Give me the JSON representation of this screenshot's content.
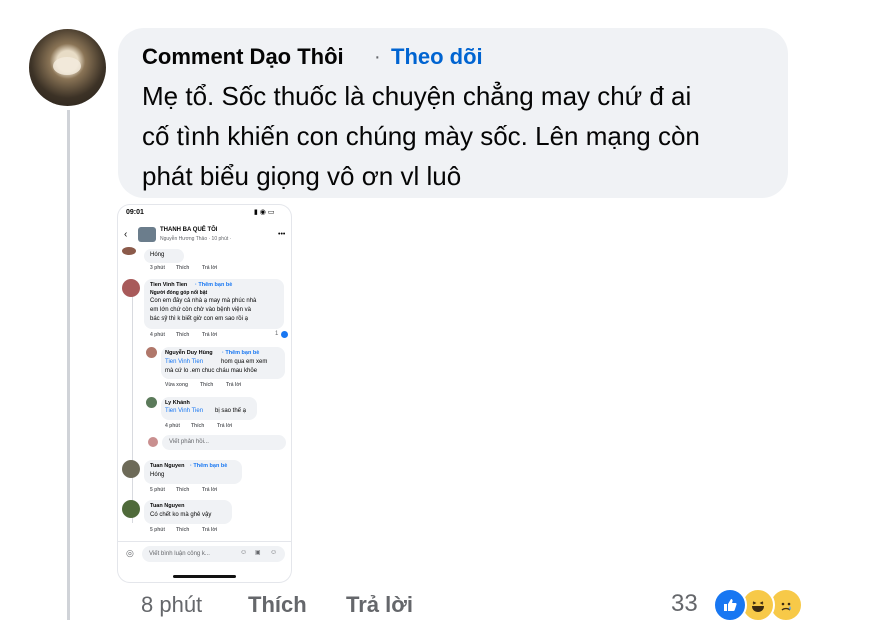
{
  "comment": {
    "author": "Comment Dạo Thôi",
    "separator": "·",
    "follow_label": "Theo dõi",
    "lines": [
      "Mẹ tổ. Sốc thuốc là chuyện chẳng may chứ đ ai",
      "cố tình khiến con chúng mày sốc. Lên mạng còn",
      "phát biểu giọng vô ơn vl luô"
    ],
    "time": "8 phút",
    "like_label": "Thích",
    "reply_label": "Trả lời",
    "reaction_count": "33",
    "reactions": [
      "like-icon",
      "haha-icon",
      "sad-icon"
    ]
  },
  "screenshot": {
    "status_time": "09:01",
    "group_title": "THANH BA QUÊ TÔI",
    "group_sub": "Nguyễn Hương Thảo · 10 phút ·",
    "items": [
      {
        "text": "Hóng",
        "time": "3 phút",
        "like": "Thích",
        "reply": "Trả lời"
      },
      {
        "name": "Tien Vinh Tien",
        "add": "· Thêm bạn bè",
        "badge": "Người đóng góp nổi bật",
        "lines": [
          "Con em đây cả nhà ạ may mà phúc nhà",
          "em lớn chứ còn chờ vào bệnh viện và",
          "bác sỹ thì k biết giờ con em sao rồi ạ"
        ],
        "time": "4 phút",
        "like": "Thích",
        "reply": "Trả lời",
        "count": "1"
      },
      {
        "name": "Nguyễn Duy Hùng",
        "add": "· Thêm bạn bè",
        "mention": "Tien Vinh Tien",
        "lines": [
          "hom qua em xem",
          "mà cứ lo .em chuc cháu mau khỏe"
        ],
        "time": "Vừa xong",
        "like": "Thích",
        "reply": "Trả lời"
      },
      {
        "name": "Ly Khánh",
        "mention": "Tien Vinh Tien",
        "text": "bị sao thế ạ",
        "time": "4 phút",
        "like": "Thích",
        "reply": "Trả lời"
      },
      {
        "reply_placeholder": "Viết phản hồi..."
      },
      {
        "name": "Tuan Nguyen",
        "add": "· Thêm bạn bè",
        "text": "Hóng",
        "time": "5 phút",
        "like": "Thích",
        "reply": "Trả lời"
      },
      {
        "name": "Tuan Nguyen",
        "text": "Có chết ko mà ghê vậy",
        "time": "5 phút",
        "like": "Thích",
        "reply": "Trả lời"
      }
    ],
    "input_placeholder": "Viết bình luận công k..."
  },
  "colors": {
    "accent": "#0064d1",
    "bubble": "#f0f2f5",
    "secondary_text": "#65676b"
  }
}
